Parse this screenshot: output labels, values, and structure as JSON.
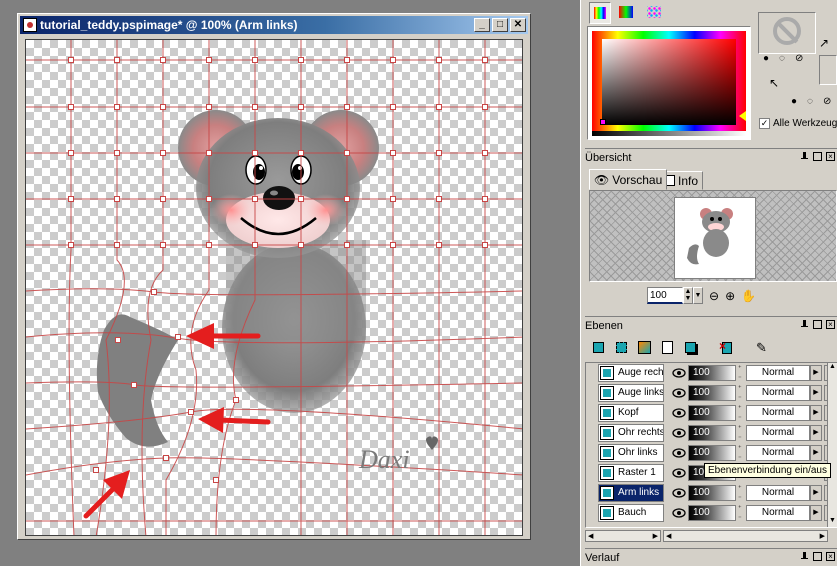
{
  "image_window": {
    "title": "tutorial_teddy.pspimage* @ 100% (Arm links)",
    "watermark": "Daxi"
  },
  "materials": {
    "all_tools_checkbox_label": "Alle Werkzeuge",
    "all_tools_checked": true
  },
  "overview": {
    "panel_title": "Übersicht",
    "tabs": [
      {
        "label": "Vorschau",
        "active": true
      },
      {
        "label": "Info",
        "active": false
      }
    ],
    "zoom_value": "100"
  },
  "layers": {
    "panel_title": "Ebenen",
    "tooltip": "Ebenenverbindung ein/aus",
    "rows": [
      {
        "name": "Auge rech",
        "opacity": "100",
        "mode": "Normal",
        "selected": false
      },
      {
        "name": "Auge links",
        "opacity": "100",
        "mode": "Normal",
        "selected": false
      },
      {
        "name": "Kopf",
        "opacity": "100",
        "mode": "Normal",
        "selected": false
      },
      {
        "name": "Ohr rechts",
        "opacity": "100",
        "mode": "Normal",
        "selected": false
      },
      {
        "name": "Ohr links",
        "opacity": "100",
        "mode": "Normal",
        "selected": false
      },
      {
        "name": "Raster 1",
        "opacity": "100",
        "mode": "",
        "selected": false
      },
      {
        "name": "Arm links",
        "opacity": "100",
        "mode": "Normal",
        "selected": true
      },
      {
        "name": "Bauch",
        "opacity": "100",
        "mode": "Normal",
        "selected": false
      }
    ]
  },
  "history": {
    "panel_title": "Verlauf"
  },
  "colors": {
    "grid_line": "#c84646",
    "arrow": "#e41e1e",
    "fur": "#8a8a8a",
    "title_bar": "#0a246a",
    "panel_bg": "#d4d0c8"
  }
}
